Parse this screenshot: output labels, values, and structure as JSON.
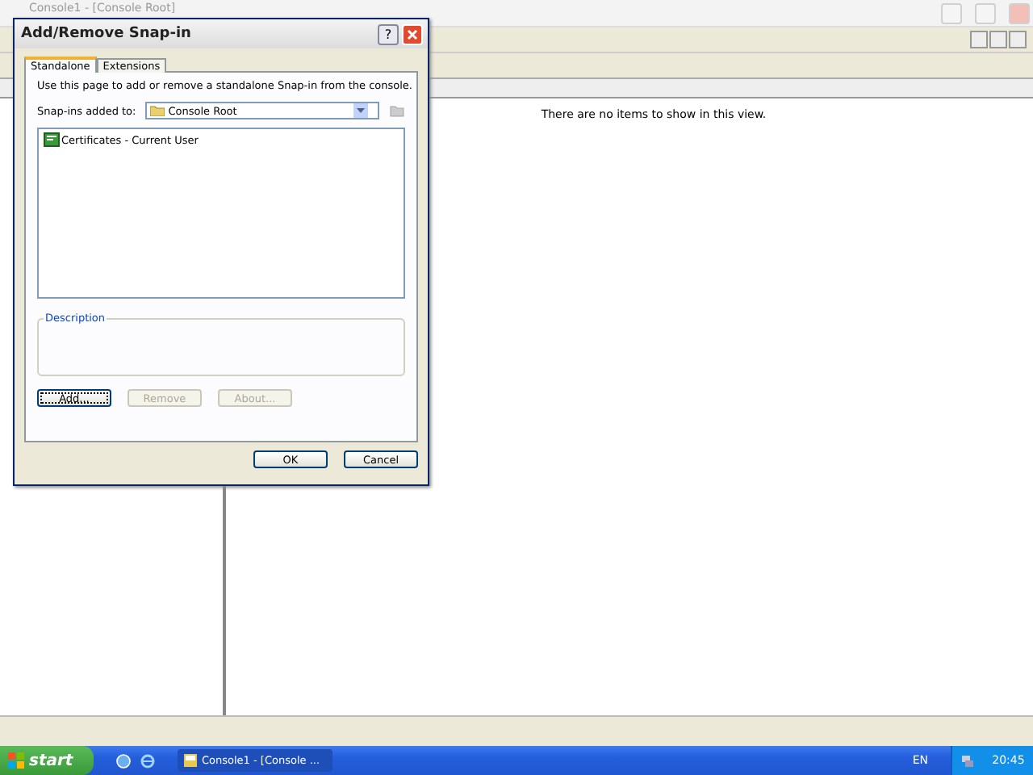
{
  "console": {
    "title": "Console1 - [Console Root]",
    "message": "There are no items to show in this view."
  },
  "dialog": {
    "title": "Add/Remove Snap-in",
    "help_button": "?",
    "tabs": [
      {
        "label": "Standalone",
        "selected": true
      },
      {
        "label": "Extensions",
        "selected": false
      }
    ],
    "intro": "Use this page to add or remove a standalone Snap-in from the console.",
    "snapin_label": "Snap-ins added to:",
    "snapin_value": "Console Root",
    "snapins": [
      {
        "label": "Certificates - Current User",
        "selected": false
      }
    ],
    "description_label": "Description",
    "actions": [
      {
        "label": "Add...",
        "disabled": false
      },
      {
        "label": "Remove",
        "disabled": true
      },
      {
        "label": "About...",
        "disabled": true
      }
    ],
    "buttons": [
      "OK",
      "Cancel"
    ]
  },
  "taskbar": {
    "start": "start",
    "tasks": [
      {
        "label": "Console1 - [Console ...",
        "selected": true
      }
    ],
    "language": "EN",
    "clock": "20:45"
  }
}
